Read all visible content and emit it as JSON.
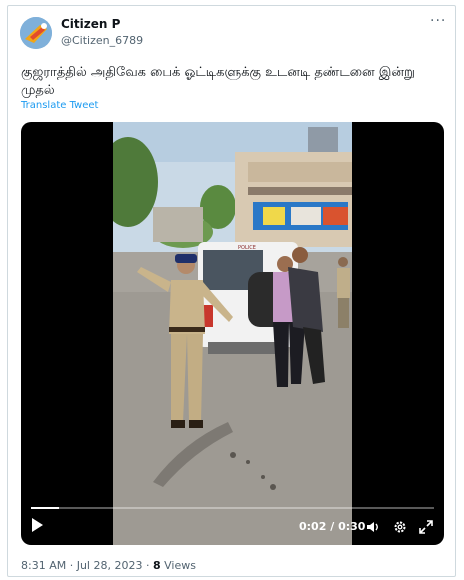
{
  "author": {
    "display_name": "Citizen P",
    "handle": "@Citizen_6789"
  },
  "more_icon": "more-dots-icon",
  "tweet": {
    "text": "குஜராத்தில் அதிவேக பைக் ஓட்டிகளுக்கு உடனடி தண்டனை இன்று முதல்",
    "translate_label": "Translate Tweet"
  },
  "video": {
    "current_time": "0:02",
    "duration": "0:30",
    "progress_fraction": 0.07,
    "icons": [
      "play-icon",
      "volume-icon",
      "settings-icon",
      "fullscreen-icon"
    ],
    "scene": {
      "van_text": "POLICE"
    }
  },
  "meta": {
    "time_date": "8:31 AM · Jul 28, 2023",
    "separator": " · ",
    "views_count": "8",
    "views_label": "Views"
  },
  "colors": {
    "link": "#1d9bf0",
    "muted": "#536471",
    "border": "#cfd9de"
  }
}
